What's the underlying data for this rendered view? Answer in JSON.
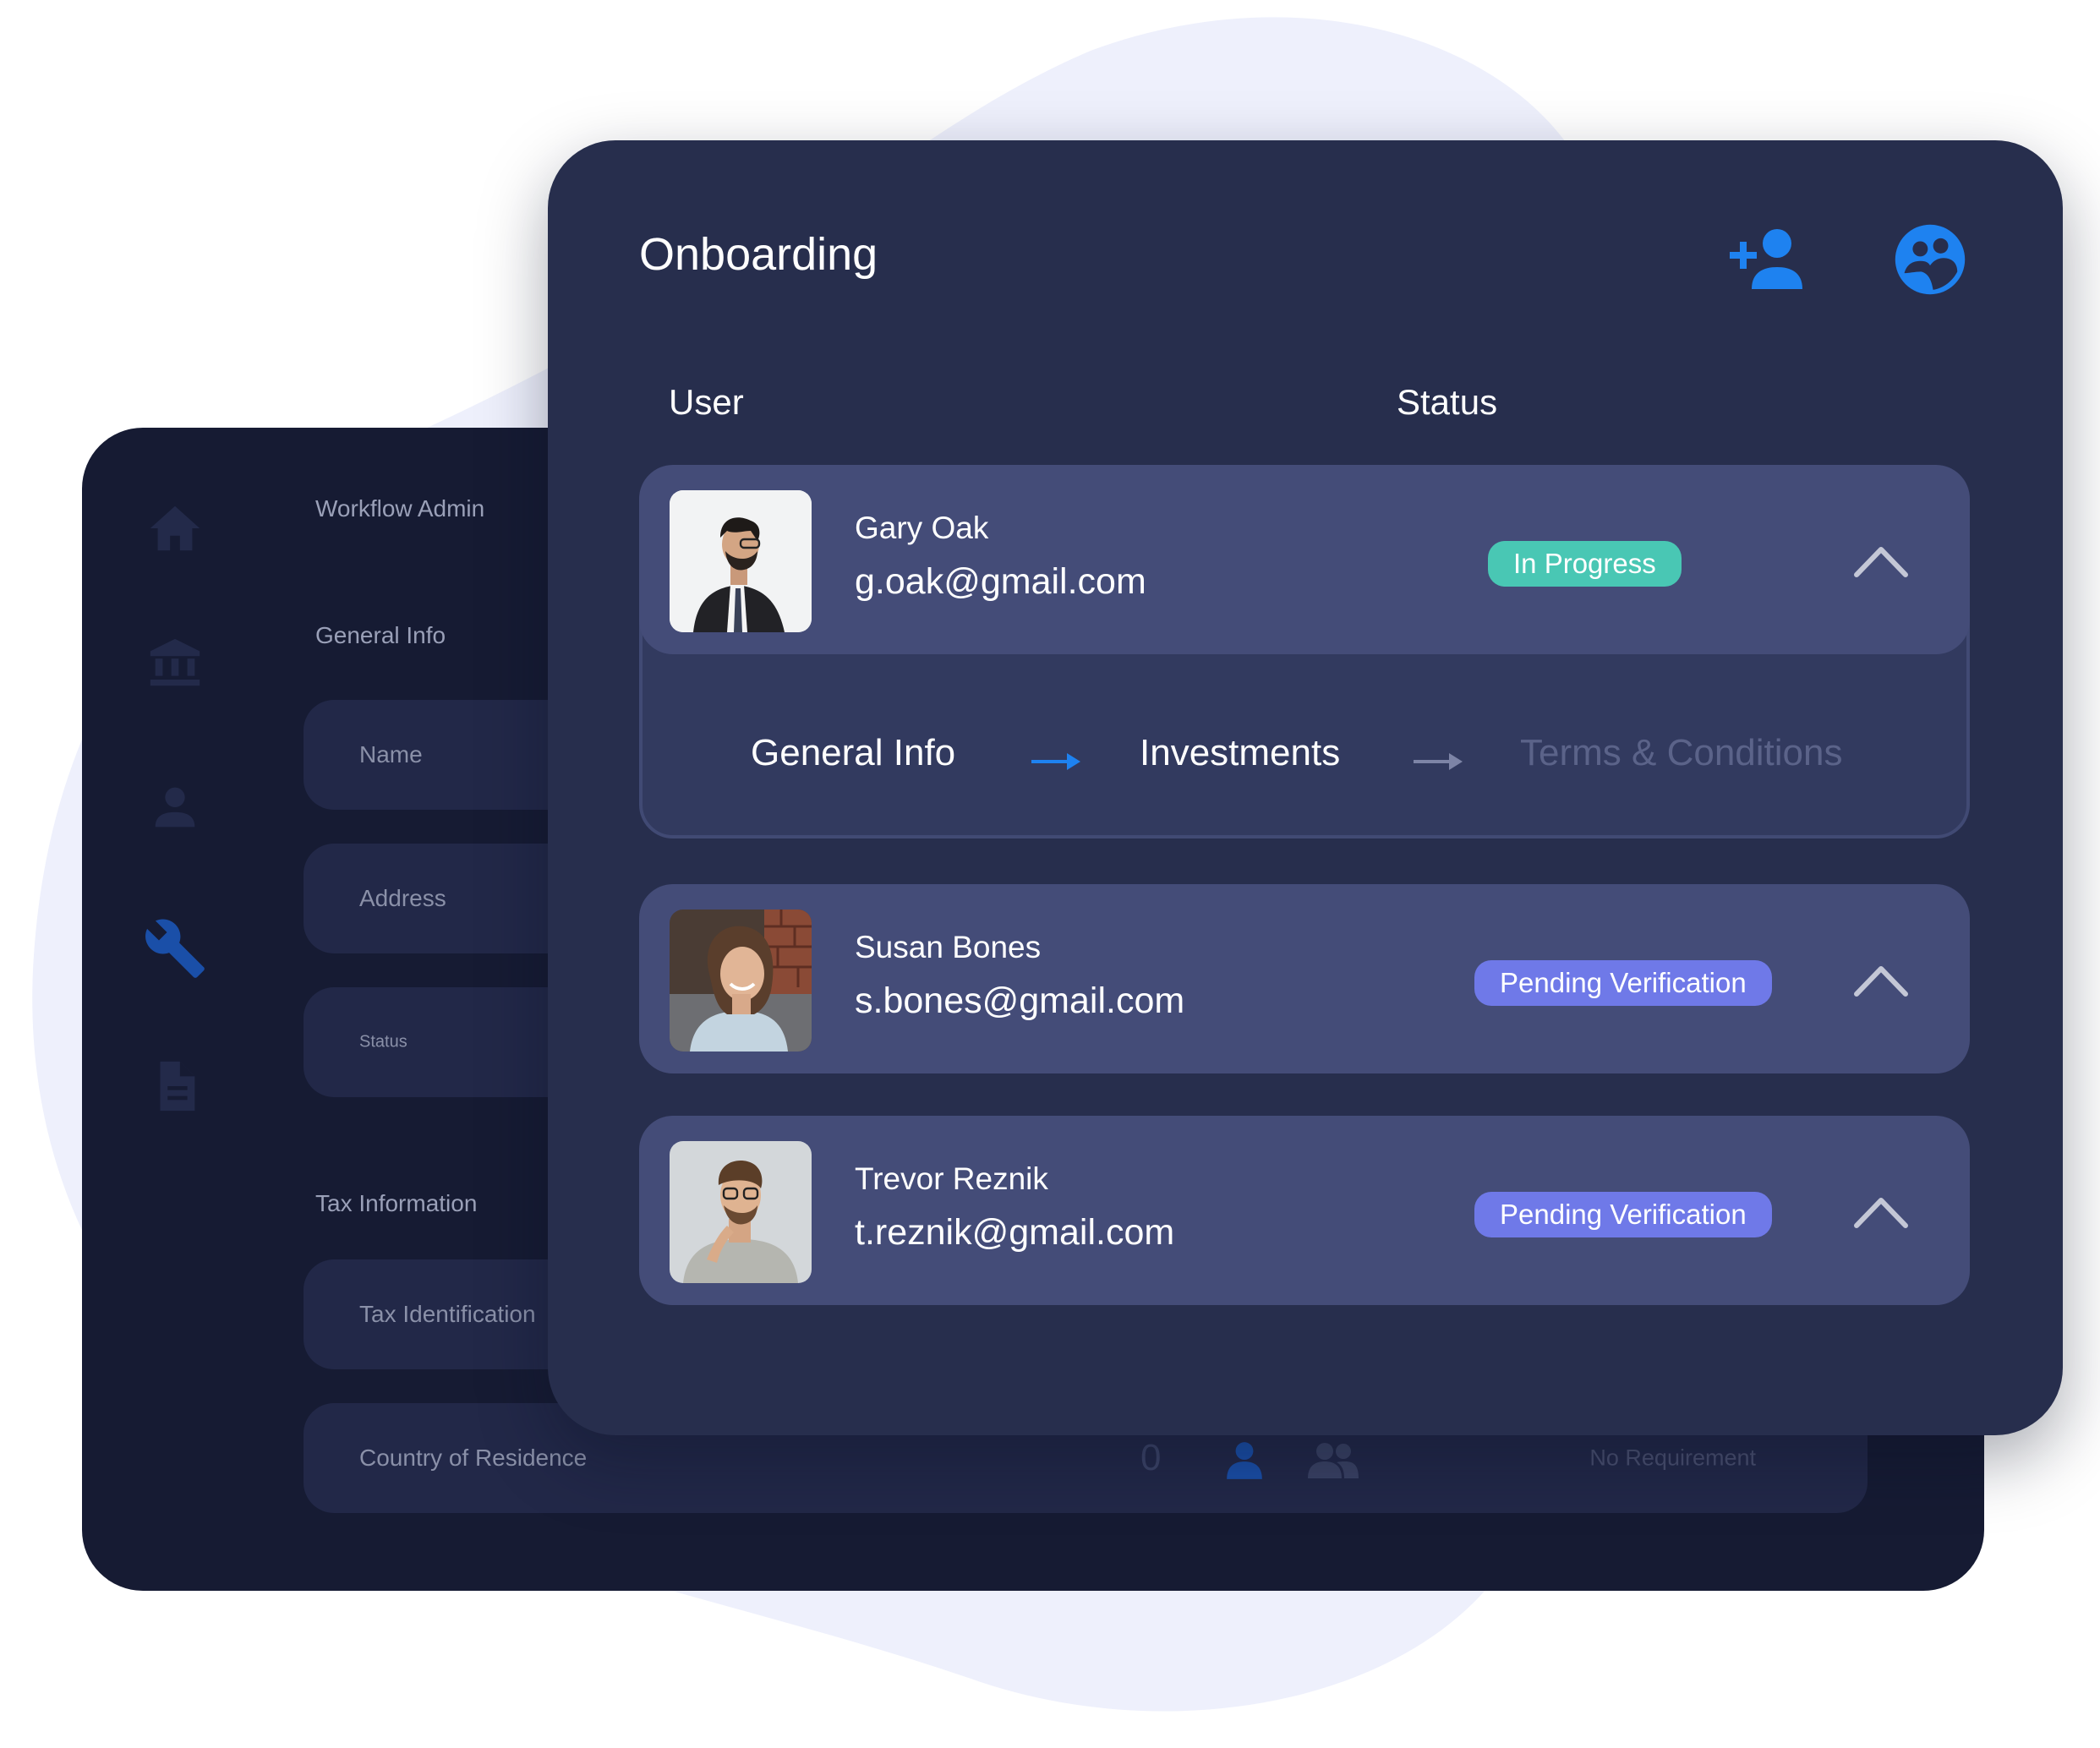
{
  "back_panel": {
    "nav_icons": [
      "home-icon",
      "bank-icon",
      "person-icon",
      "wrench-icon",
      "document-icon"
    ],
    "workflow_label": "Workflow Admin",
    "general_info_label": "General Info",
    "fields": {
      "name": "Name",
      "address": "Address",
      "status": "Status",
      "tax_id": "Tax Identification",
      "country": "Country of Residence"
    },
    "tax_info_label": "Tax Information",
    "country_count": "0",
    "country_requirement": "No Requirement"
  },
  "front_panel": {
    "title": "Onboarding",
    "header_icons": [
      "add-user-icon",
      "account-circle-icon"
    ],
    "columns": {
      "user": "User",
      "status": "Status"
    },
    "users": [
      {
        "name": "Gary Oak",
        "email": "g.oak@gmail.com",
        "status": "In Progress",
        "status_color": "#49c7b4",
        "expanded": true
      },
      {
        "name": "Susan Bones",
        "email": "s.bones@gmail.com",
        "status": "Pending Verification",
        "status_color": "#6f79e8",
        "expanded": false
      },
      {
        "name": "Trevor Reznik",
        "email": "t.reznik@gmail.com",
        "status": "Pending Verification",
        "status_color": "#6f79e8",
        "expanded": false
      }
    ],
    "steps": [
      {
        "label": "General Info",
        "state": "done"
      },
      {
        "label": "Investments",
        "state": "current"
      },
      {
        "label": "Terms & Conditions",
        "state": "upcoming"
      }
    ]
  },
  "colors": {
    "accent_blue": "#1e82f0",
    "front_bg": "#272e4d",
    "back_bg": "#161b33",
    "row_bg": "#444c78"
  }
}
